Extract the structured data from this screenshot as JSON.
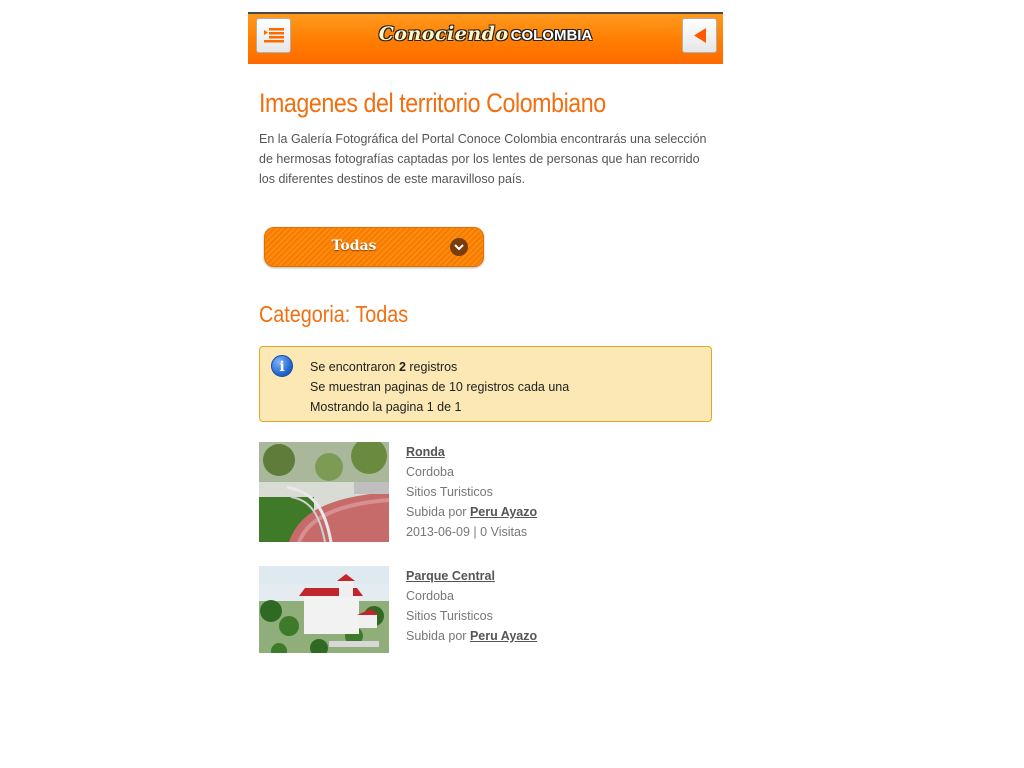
{
  "header": {
    "logo_script": "Conociendo",
    "logo_caps": "COLOMBIA",
    "menu_icon": "menu-list-icon",
    "back_icon": "back-arrow-icon"
  },
  "page": {
    "title": "Imagenes del territorio Colombiano",
    "intro": "En la Galería Fotográfica del Portal Conoce Colombia encontrarás una selección de hermosas fotografías captadas por los lentes de personas que han recorrido los diferentes destinos de este maravilloso país."
  },
  "filter": {
    "selected": "Todas"
  },
  "category": {
    "heading": "Categoria: Todas"
  },
  "info": {
    "line1_prefix": "Se encontraron ",
    "count": "2",
    "line1_suffix": " registros",
    "line2": "Se muestran paginas de 10 registros cada una",
    "line3": "Mostrando la pagina 1 de 1"
  },
  "items": [
    {
      "title": "Ronda",
      "location": "Cordoba",
      "category": "Sitios Turisticos",
      "uploaded_label": "Subida por",
      "author": "Peru Ayazo",
      "date": "2013-06-09",
      "visits": "0 Visitas"
    },
    {
      "title": "Parque Central",
      "location": "Cordoba",
      "category": "Sitios Turisticos",
      "uploaded_label": "Subida por",
      "author": "Peru Ayazo"
    }
  ],
  "colors": {
    "accent": "#f26f10",
    "header_orange": "#ff7d00",
    "info_bg": "#fbe8b4",
    "info_border": "#e7a81f"
  }
}
